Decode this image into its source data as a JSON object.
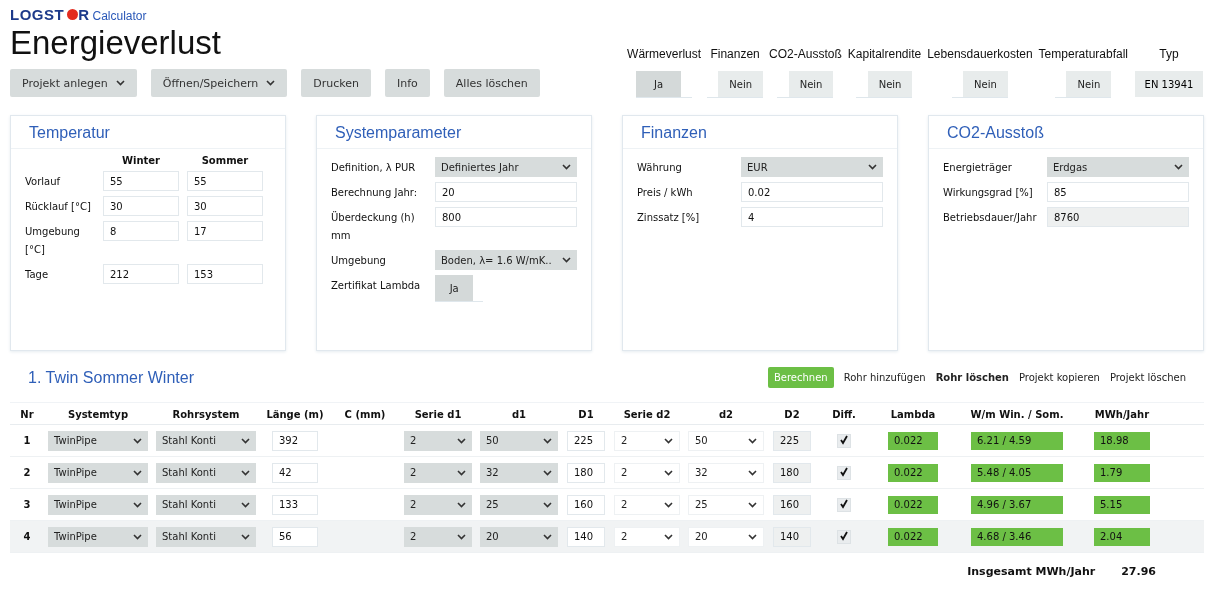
{
  "brand": {
    "logo_left": "LOGST",
    "logo_right": "R",
    "product": "Calculator"
  },
  "title": "Energieverlust",
  "toolbar": [
    {
      "label": "Projekt anlegen",
      "dropdown": true
    },
    {
      "label": "Öffnen/Speichern",
      "dropdown": true
    },
    {
      "label": "Drucken",
      "dropdown": false
    },
    {
      "label": "Info",
      "dropdown": false
    },
    {
      "label": "Alles löschen",
      "dropdown": false
    }
  ],
  "toggles": [
    {
      "label": "Wärmeverlust",
      "value": "Ja",
      "on": true
    },
    {
      "label": "Finanzen",
      "value": "Nein",
      "on": false
    },
    {
      "label": "CO2-Ausstoß",
      "value": "Nein",
      "on": false
    },
    {
      "label": "Kapitalrendite",
      "value": "Nein",
      "on": false
    },
    {
      "label": "Lebensdauerkosten",
      "value": "Nein",
      "on": false
    },
    {
      "label": "Temperaturabfall",
      "value": "Nein",
      "on": false
    },
    {
      "label": "Typ",
      "value": "EN 13941",
      "kind": "plain"
    }
  ],
  "temperatur": {
    "title": "Temperatur",
    "columns": [
      "Winter",
      "Sommer"
    ],
    "rows": [
      {
        "label": "Vorlauf",
        "values": [
          "55",
          "55"
        ]
      },
      {
        "label": "Rücklauf [°C]",
        "values": [
          "30",
          "30"
        ]
      },
      {
        "label": "Umgebung [°C]",
        "values": [
          "8",
          "17"
        ]
      },
      {
        "label": "Tage",
        "values": [
          "212",
          "153"
        ]
      }
    ]
  },
  "cards": [
    {
      "title": "Systemparameter",
      "fields": [
        {
          "label": "Definition, λ PUR",
          "kind": "select",
          "value": "Definiertes Jahr"
        },
        {
          "label": "Berechnung Jahr:",
          "kind": "input",
          "value": "20"
        },
        {
          "label": "Überdeckung (h) mm",
          "kind": "input",
          "value": "800"
        },
        {
          "label": "Umgebung",
          "kind": "select",
          "value": "Boden, λ= 1.6 W/mK.."
        },
        {
          "label": "Zertifikat Lambda",
          "kind": "toggle",
          "value": "Ja",
          "on": true
        }
      ]
    },
    {
      "title": "Finanzen",
      "fields": [
        {
          "label": "Währung",
          "kind": "select",
          "value": "EUR"
        },
        {
          "label": "Preis / kWh",
          "kind": "input",
          "value": "0.02"
        },
        {
          "label": "Zinssatz [%]",
          "kind": "input",
          "value": "4"
        }
      ]
    },
    {
      "title": "CO2-Ausstoß",
      "fields": [
        {
          "label": "Energieträger",
          "kind": "select",
          "value": "Erdgas"
        },
        {
          "label": "Wirkungsgrad [%]",
          "kind": "input",
          "value": "85"
        },
        {
          "label": "Betriebsdauer/Jahr",
          "kind": "readonly",
          "value": "8760"
        }
      ]
    }
  ],
  "section_title": "1. Twin Sommer Winter",
  "actions": [
    {
      "label": "Berechnen",
      "kind": "primary"
    },
    {
      "label": "Rohr hinzufügen",
      "kind": "link"
    },
    {
      "label": "Rohr löschen",
      "kind": "strong"
    },
    {
      "label": "Projekt kopieren",
      "kind": "link"
    },
    {
      "label": "Projekt löschen",
      "kind": "link"
    }
  ],
  "table": {
    "columns": [
      "Nr",
      "Systemtyp",
      "Rohrsystem",
      "Länge (m)",
      "C (mm)",
      "Serie d1",
      "d1",
      "D1",
      "Serie d2",
      "d2",
      "D2",
      "Diff.",
      "Lambda",
      "W/m Win. / Som.",
      "MWh/Jahr"
    ],
    "rows": [
      {
        "nr": "1",
        "systemtyp": "TwinPipe",
        "rohrsystem": "Stahl Konti",
        "laenge": "392",
        "serie_d1": "2",
        "d1": "50",
        "D1": "225",
        "serie_d2": "2",
        "d2": "50",
        "D2": "225",
        "diff": true,
        "lambda": "0.022",
        "wm": "6.21 / 4.59",
        "mwh": "18.98",
        "selected": false
      },
      {
        "nr": "2",
        "systemtyp": "TwinPipe",
        "rohrsystem": "Stahl Konti",
        "laenge": "42",
        "serie_d1": "2",
        "d1": "32",
        "D1": "180",
        "serie_d2": "2",
        "d2": "32",
        "D2": "180",
        "diff": true,
        "lambda": "0.022",
        "wm": "5.48 / 4.05",
        "mwh": "1.79",
        "selected": false
      },
      {
        "nr": "3",
        "systemtyp": "TwinPipe",
        "rohrsystem": "Stahl Konti",
        "laenge": "133",
        "serie_d1": "2",
        "d1": "25",
        "D1": "160",
        "serie_d2": "2",
        "d2": "25",
        "D2": "160",
        "diff": true,
        "lambda": "0.022",
        "wm": "4.96 / 3.67",
        "mwh": "5.15",
        "selected": false
      },
      {
        "nr": "4",
        "systemtyp": "TwinPipe",
        "rohrsystem": "Stahl Konti",
        "laenge": "56",
        "serie_d1": "2",
        "d1": "20",
        "D1": "140",
        "serie_d2": "2",
        "d2": "20",
        "D2": "140",
        "diff": true,
        "lambda": "0.022",
        "wm": "4.68 / 3.46",
        "mwh": "2.04",
        "selected": true
      }
    ],
    "total_label": "Insgesamt MWh/Jahr",
    "total": "27.96"
  }
}
